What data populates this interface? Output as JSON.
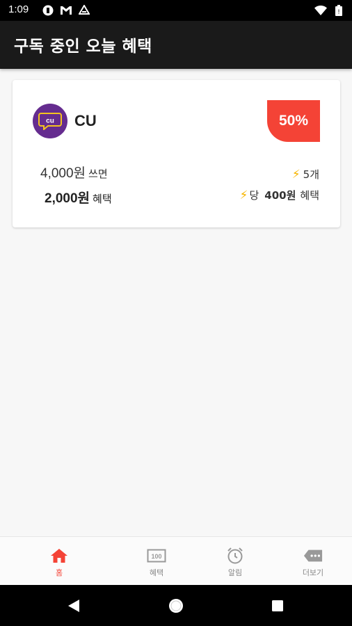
{
  "status_bar": {
    "time": "1:09"
  },
  "app_bar": {
    "title": "구독 중인 오늘 혜택"
  },
  "card": {
    "brand_name": "CU",
    "discount_badge": "50%",
    "spend_amount": "4,000원",
    "spend_label": "쓰면",
    "benefit_amount": "2,000원",
    "benefit_label": "혜택",
    "count": "5개",
    "per_prefix": "당",
    "per_amount": "400원",
    "per_label": "혜택"
  },
  "bottom_nav": [
    {
      "label": "홈",
      "icon": "home-icon",
      "active": true
    },
    {
      "label": "혜택",
      "icon": "coupon-icon",
      "active": false
    },
    {
      "label": "알림",
      "icon": "alarm-icon",
      "active": false
    },
    {
      "label": "더보기",
      "icon": "more-icon",
      "active": false
    }
  ],
  "colors": {
    "accent": "#f44336",
    "app_bar": "#1a1a1a",
    "brand_logo": "#652c8f",
    "bolt": "#f7b500"
  }
}
